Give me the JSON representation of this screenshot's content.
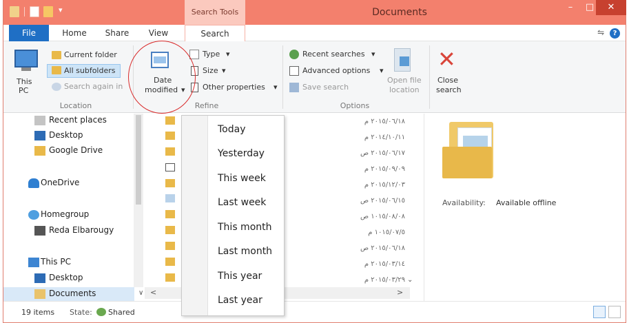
{
  "window": {
    "title": "Documents",
    "context_group": "Search Tools"
  },
  "controls": {
    "minimize": "–",
    "maximize": "□",
    "close": "✕"
  },
  "tabs": {
    "file": "File",
    "home": "Home",
    "share": "Share",
    "view": "View",
    "search": "Search"
  },
  "ribbon": {
    "location": {
      "this_pc_line1": "This",
      "this_pc_line2": "PC",
      "current_folder": "Current folder",
      "all_subfolders": "All subfolders",
      "search_again": "Search again in",
      "label": "Location"
    },
    "refine": {
      "date_line1": "Date",
      "date_line2": "modified",
      "type": "Type",
      "size": "Size",
      "other": "Other properties",
      "label": "Refine"
    },
    "options": {
      "recent": "Recent searches",
      "advanced": "Advanced options",
      "save": "Save search",
      "open_line1": "Open file",
      "open_line2": "location",
      "label": "Options"
    },
    "close": {
      "line1": "Close",
      "line2": "search"
    }
  },
  "nav": {
    "recent": "Recent places",
    "desktop": "Desktop",
    "gdrive": "Google Drive",
    "onedrive": "OneDrive",
    "homegroup": "Homegroup",
    "user": "Reda Elbarougy",
    "thispc": "This PC",
    "pc_desktop": "Desktop",
    "documents": "Documents"
  },
  "files": {
    "dates": [
      "٢٠١٥/٠٦/١٨ م",
      "٢٠١٤/١٠/١١ م",
      "٢٠١٥/٠٦/١٧ ص",
      "٢٠١٥/٠٩/٠٩ م",
      "٢٠١٥/١٢/٠٣ م",
      "٢٠١٥/٠٦/١٥ ص",
      "١٠١٥/٠٨/٠٨ ص",
      "١٠١٥/٠٧/٥ م",
      "٢٠١٥/٠٦/١٨ ص",
      "٢٠١٥/٠٣/١٤ م",
      "٢٠١٥/٠٣/٢٩ م"
    ]
  },
  "details": {
    "availability_label": "Availability:",
    "availability_value": "Available offline"
  },
  "dropdown": [
    "Today",
    "Yesterday",
    "This week",
    "Last week",
    "This month",
    "Last month",
    "This year",
    "Last year"
  ],
  "status": {
    "items": "19 items",
    "state_label": "State:",
    "state_value": "Shared"
  },
  "colors": {
    "titlebar": "#f3806d",
    "file_tab": "#1f6fc5",
    "highlight": "#cde4f7",
    "annotation": "#d92b2b"
  }
}
